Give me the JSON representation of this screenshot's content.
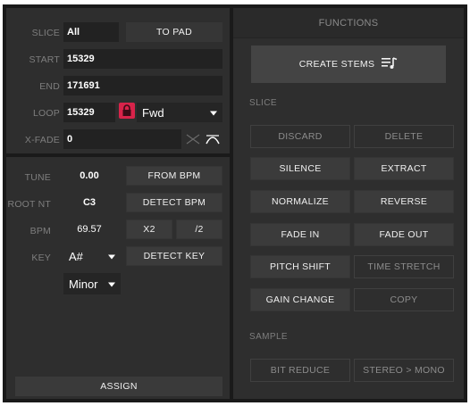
{
  "slice_panel": {
    "slice_label": "SLICE",
    "slice_value": "All",
    "to_pad_label": "TO PAD",
    "start_label": "START",
    "start_value": "15329",
    "end_label": "END",
    "end_value": "171691",
    "loop_label": "LOOP",
    "loop_value": "15329",
    "loop_direction": "Fwd",
    "xfade_label": "X-FADE",
    "xfade_value": "0"
  },
  "tune_panel": {
    "tune_label": "TUNE",
    "tune_value": "0.00",
    "root_label": "ROOT NT",
    "root_value": "C3",
    "bpm_label": "BPM",
    "bpm_value": "69.57",
    "key_label": "KEY",
    "key_value": "A#",
    "scale_value": "Minor",
    "from_bpm_label": "FROM BPM",
    "detect_bpm_label": "DETECT BPM",
    "x2_label": "X2",
    "half_label": "/2",
    "detect_key_label": "DETECT KEY",
    "assign_label": "ASSIGN"
  },
  "functions_panel": {
    "title": "FUNCTIONS",
    "create_stems_label": "CREATE STEMS",
    "slice_section": "SLICE",
    "sample_section": "SAMPLE",
    "buttons": {
      "discard": "DISCARD",
      "delete": "DELETE",
      "silence": "SILENCE",
      "extract": "EXTRACT",
      "normalize": "NORMALIZE",
      "reverse": "REVERSE",
      "fade_in": "FADE IN",
      "fade_out": "FADE OUT",
      "pitch_shift": "PITCH SHIFT",
      "time_stretch": "TIME STRETCH",
      "gain_change": "GAIN CHANGE",
      "copy": "COPY",
      "bit_reduce": "BIT REDUCE",
      "stereo_mono": "STEREO > MONO"
    }
  },
  "colors": {
    "accent_red": "#d8234a",
    "panel_bg": "#2e2e2e",
    "frame_bg": "#1a1a1a"
  }
}
